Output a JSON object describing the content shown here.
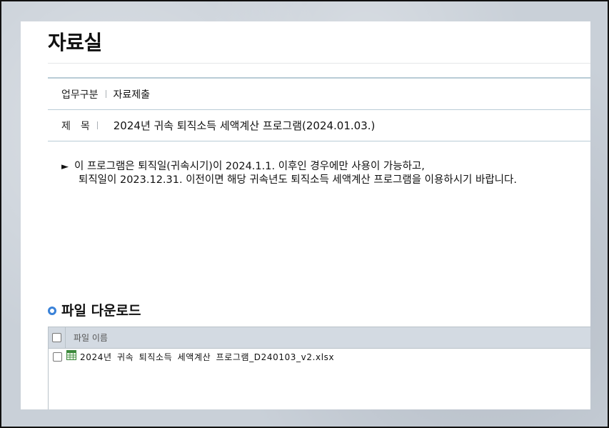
{
  "page": {
    "title": "자료실"
  },
  "info": {
    "category_label": "업무구분",
    "category_value": "자료제출",
    "subject_label": "제목",
    "subject_value": "2024년 귀속 퇴직소득 세액계산 프로그램(2024.01.03.)"
  },
  "notice": {
    "bullet": "►",
    "line1": "이 프로그램은 퇴직일(귀속시기)이 2024.1.1. 이후인 경우에만 사용이 가능하고,",
    "line2": "퇴직일이 2023.12.31. 이전이면 해당 귀속년도 퇴직소득 세액계산 프로그램을 이용하시기 바랍니다."
  },
  "downloads": {
    "section_title": "파일 다운로드",
    "column_header": "파일 이름",
    "files": [
      {
        "name": "2024년 귀속 퇴직소득 세액계산 프로그램_D240103_v2.xlsx",
        "icon": "excel-file-icon"
      }
    ]
  },
  "colors": {
    "accent": "#3a82d8",
    "table_header_bg": "#d3dae2",
    "rule": "#b9ccd6"
  }
}
